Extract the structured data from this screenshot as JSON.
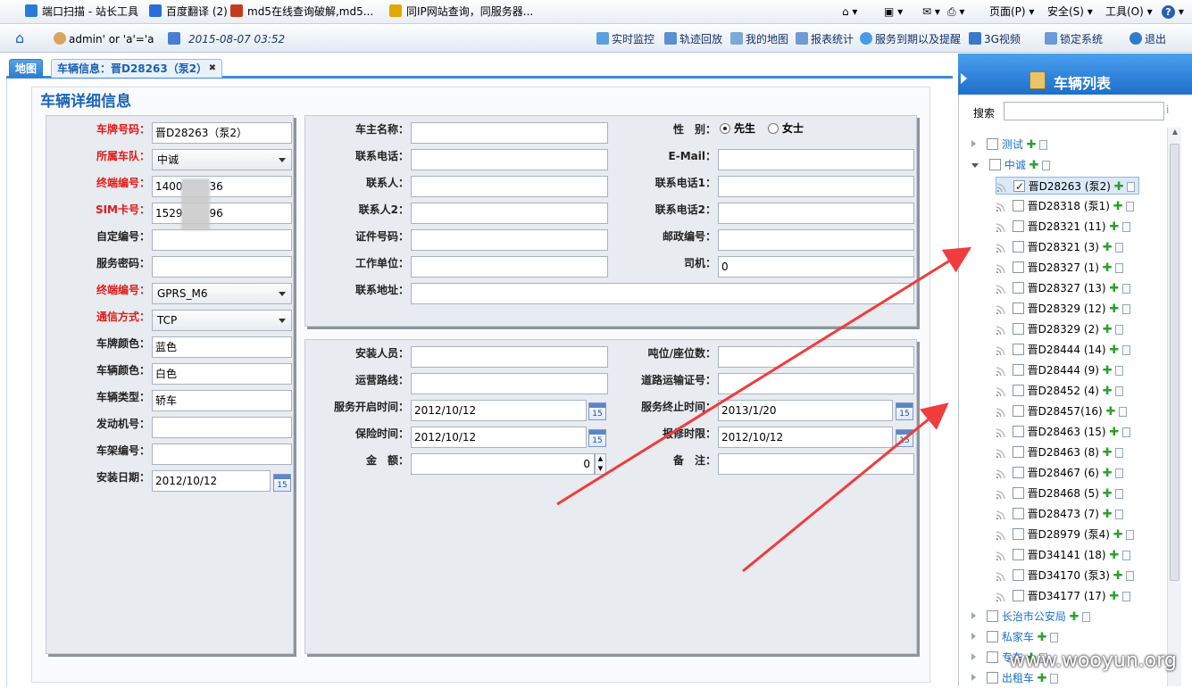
{
  "favorites": [
    {
      "label": "端口扫描 - 站长工具",
      "color": "#2a7bd6"
    },
    {
      "label": "百度翻译 (2)",
      "color": "#2a6fd6"
    },
    {
      "label": "md5在线查询破解,md5...",
      "color": "#c43b1d"
    },
    {
      "label": "同IP网站查询，同服务器...",
      "color": "#e0a800"
    }
  ],
  "ie_toolbar": {
    "page": "页面(P)",
    "safety": "安全(S)",
    "tools": "工具(O)"
  },
  "header": {
    "user": "admin' or 'a'='a",
    "datetime": "2015-08-07 03:52",
    "nav": [
      "实时监控",
      "轨迹回放",
      "我的地图",
      "报表统计",
      "服务到期以及提醒",
      "3G视频",
      "锁定系统",
      "退出"
    ]
  },
  "tabs": {
    "map": "地图",
    "vehicle": "车辆信息：晋D28263（泵2）"
  },
  "panel_title": "车辆详细信息",
  "left_form": {
    "plate": {
      "label": "车牌号码：",
      "value": "晋D28263（泵2）"
    },
    "team": {
      "label": "所属车队：",
      "value": "中诚"
    },
    "terminal_no": {
      "label": "终端编号：",
      "value": "1400",
      "value_tail": "36"
    },
    "sim": {
      "label": "SIM卡号：",
      "value": "1529",
      "value_tail": "96"
    },
    "custom_no": {
      "label": "自定编号：",
      "value": ""
    },
    "service_pwd": {
      "label": "服务密码：",
      "value": ""
    },
    "terminal_type": {
      "label": "终端编号：",
      "value": "GPRS_M6"
    },
    "comm": {
      "label": "通信方式：",
      "value": "TCP"
    },
    "plate_color": {
      "label": "车牌颜色：",
      "value": "蓝色"
    },
    "car_color": {
      "label": "车辆颜色：",
      "value": "白色"
    },
    "car_type": {
      "label": "车辆类型：",
      "value": "轿车"
    },
    "engine_no": {
      "label": "发动机号：",
      "value": ""
    },
    "frame_no": {
      "label": "车架编号：",
      "value": ""
    },
    "install_date": {
      "label": "安装日期：",
      "value": "2012/10/12"
    }
  },
  "calendar_day": "15",
  "owner_form": {
    "owner": "车主名称：",
    "phone": "联系电话：",
    "contact": "联系人：",
    "contact2": "联系人2：",
    "id_no": "证件号码：",
    "company": "工作单位：",
    "address": "联系地址：",
    "gender": "性　别：",
    "male": "先生",
    "female": "女士",
    "email": "E-Mail：",
    "contact_phone1": "联系电话1：",
    "contact_phone2": "联系电话2：",
    "postcode": "邮政编号：",
    "driver": "司机：",
    "driver_value": "0"
  },
  "service_form": {
    "installer": "安装人员：",
    "route": "运营路线：",
    "start": "服务开启时间：",
    "start_value": "2012/10/12",
    "insurance": "保险时间：",
    "insurance_value": "2012/10/12",
    "amount": "金　额：",
    "amount_value": "0",
    "tonnage": "吨位/座位数：",
    "license": "道路运输证号：",
    "end": "服务终止时间：",
    "end_value": "2013/1/20",
    "repair": "报修时限：",
    "repair_value": "2012/10/12",
    "remark": "备　注："
  },
  "sidebar": {
    "title": "车辆列表",
    "search_label": "搜索",
    "groups_top": [
      {
        "label": "测试",
        "expanded": false
      },
      {
        "label": "中诚",
        "expanded": true
      }
    ],
    "vehicles": [
      {
        "label": "晋D28263 (泵2)",
        "checked": true
      },
      {
        "label": "晋D28318 (泵1)",
        "checked": false
      },
      {
        "label": "晋D28321 (11)",
        "checked": false
      },
      {
        "label": "晋D28321 (3)",
        "checked": false
      },
      {
        "label": "晋D28327 (1)",
        "checked": false
      },
      {
        "label": "晋D28327 (13)",
        "checked": false
      },
      {
        "label": "晋D28329 (12)",
        "checked": false
      },
      {
        "label": "晋D28329 (2)",
        "checked": false
      },
      {
        "label": "晋D28444 (14)",
        "checked": false
      },
      {
        "label": "晋D28444 (9)",
        "checked": false
      },
      {
        "label": "晋D28452 (4)",
        "checked": false
      },
      {
        "label": "晋D28457(16)",
        "checked": false
      },
      {
        "label": "晋D28463 (15)",
        "checked": false
      },
      {
        "label": "晋D28463 (8)",
        "checked": false
      },
      {
        "label": "晋D28467 (6)",
        "checked": false
      },
      {
        "label": "晋D28468 (5)",
        "checked": false
      },
      {
        "label": "晋D28473 (7)",
        "checked": false
      },
      {
        "label": "晋D28979 (泵4)",
        "checked": false
      },
      {
        "label": "晋D34141 (18)",
        "checked": false
      },
      {
        "label": "晋D34170 (泵3)",
        "checked": false
      },
      {
        "label": "晋D34177 (17)",
        "checked": false
      }
    ],
    "groups_bottom": [
      "长治市公安局",
      "私家车",
      "专车",
      "出租车"
    ]
  },
  "watermark": "www.wooyun.org",
  "colors": {
    "accent": "#1a64b8",
    "required_label": "#e01a1a",
    "arrow": "#f03c3c"
  }
}
